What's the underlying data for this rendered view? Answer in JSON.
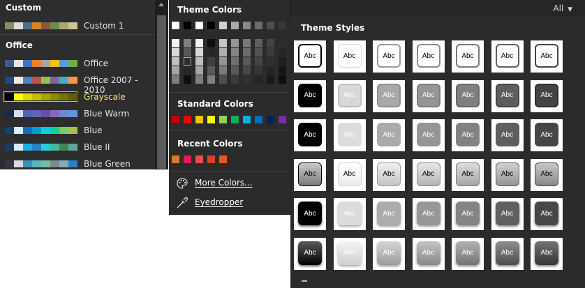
{
  "variants": {
    "custom_heading": "Custom",
    "office_heading": "Office",
    "items": [
      {
        "name": "Custom 1",
        "colors": [
          "#8a8a6c",
          "#dcdcdc",
          "#4a6e8c",
          "#d4852a",
          "#8c5a3a",
          "#6e8a4e",
          "#a8a86a",
          "#c8c890"
        ],
        "selected": false
      },
      {
        "name": "Office",
        "colors": [
          "#3c5a8c",
          "#e6e6e6",
          "#4472c4",
          "#ed7d31",
          "#a5a5a5",
          "#ffc000",
          "#5b9bd5",
          "#70ad47"
        ],
        "selected": false
      },
      {
        "name": "Office 2007 - 2010",
        "colors": [
          "#1f497d",
          "#eeece1",
          "#4f81bd",
          "#c0504d",
          "#9bbb59",
          "#8064a2",
          "#4bacc6",
          "#f79646"
        ],
        "selected": false
      },
      {
        "name": "Grayscale",
        "colors": [
          "#000000",
          "#ffff00",
          "#e0d800",
          "#c8c000",
          "#aaa400",
          "#908a00",
          "#787400",
          "#605e00"
        ],
        "selected": true
      },
      {
        "name": "Blue Warm",
        "colors": [
          "#1a2a4c",
          "#d8dce8",
          "#4a66ac",
          "#5a6ab0",
          "#6a4ea0",
          "#8a68b8",
          "#6a8ac8",
          "#5a9ad8"
        ],
        "selected": false
      },
      {
        "name": "Blue",
        "colors": [
          "#17406d",
          "#dbeff9",
          "#0f6fc6",
          "#009dd9",
          "#0bd0d9",
          "#10cf9b",
          "#7cca62",
          "#a5c249"
        ],
        "selected": false
      },
      {
        "name": "Blue II",
        "colors": [
          "#1c3a6a",
          "#e0e8f0",
          "#1cade4",
          "#2683c6",
          "#27ced7",
          "#42ba97",
          "#3e8853",
          "#62a39f"
        ],
        "selected": false
      },
      {
        "name": "Blue Green",
        "colors": [
          "#373545",
          "#dcd8dc",
          "#3494ba",
          "#58b6c0",
          "#75bda7",
          "#7a8c8e",
          "#84acb6",
          "#2683c6"
        ],
        "selected": false
      }
    ]
  },
  "color_popup": {
    "theme_colors_heading": "Theme Colors",
    "theme_top_row": [
      "#ffffff",
      "#000000",
      "#ffffff",
      "#000000",
      "#d0d0d0",
      "#a8a8a8",
      "#888888",
      "#6c6c6c",
      "#4e4e4e",
      "#383838"
    ],
    "theme_shades": [
      [
        "#f2f2f2",
        "#7f7f7f",
        "#f2f2f2",
        "#0d0d0d",
        "#c6c6c6",
        "#969696",
        "#7a7a7a",
        "#5f5f5f",
        "#444444",
        "#2e2e2e"
      ],
      [
        "#d9d9d9",
        "#595959",
        "#d9d9d9",
        "#262626",
        "#b0b0b0",
        "#858585",
        "#6b6b6b",
        "#525252",
        "#3a3a3a",
        "#262626"
      ],
      [
        "#bfbfbf",
        "#404040",
        "#bfbfbf",
        "#404040",
        "#969696",
        "#707070",
        "#5a5a5a",
        "#454545",
        "#2f2f2f",
        "#1e1e1e"
      ],
      [
        "#a6a6a6",
        "#262626",
        "#a6a6a6",
        "#595959",
        "#7a7a7a",
        "#5a5a5a",
        "#484848",
        "#363636",
        "#242424",
        "#161616"
      ],
      [
        "#7f7f7f",
        "#0d0d0d",
        "#7f7f7f",
        "#7f7f7f",
        "#505050",
        "#3c3c3c",
        "#303030",
        "#242424",
        "#181818",
        "#0e0e0e"
      ]
    ],
    "standard_colors_heading": "Standard Colors",
    "standard_colors": [
      "#c00000",
      "#ff0000",
      "#ffc000",
      "#ffff00",
      "#92d050",
      "#00b050",
      "#00b0f0",
      "#0070c0",
      "#002060",
      "#7030a0"
    ],
    "recent_colors_heading": "Recent Colors",
    "recent_colors": [
      "#e07a18",
      "#e8185a",
      "#e84c4c",
      "#e0402a",
      "#e85a14"
    ],
    "more_colors_label": "More Colors...",
    "eyedropper_label": "Eyedropper",
    "icons": {
      "more_colors": "palette-icon",
      "eyedropper": "eyedropper-icon"
    }
  },
  "theme_styles": {
    "filter_label": "All",
    "heading": "Theme Styles",
    "tile_text": "Abc",
    "rows": [
      [
        {
          "fill": "#ffffff",
          "text": "#000000",
          "border": "#000000",
          "bw": 2,
          "shadow": ""
        },
        {
          "fill": "#ffffff",
          "text": "#000000",
          "border": "#d8d8d8",
          "bw": 1,
          "shadow": ""
        },
        {
          "fill": "#ffffff",
          "text": "#000000",
          "border": "#9a9a9a",
          "bw": 2,
          "shadow": ""
        },
        {
          "fill": "#ffffff",
          "text": "#000000",
          "border": "#8c8c8c",
          "bw": 2,
          "shadow": ""
        },
        {
          "fill": "#ffffff",
          "text": "#000000",
          "border": "#7a7a7a",
          "bw": 2,
          "shadow": ""
        },
        {
          "fill": "#ffffff",
          "text": "#000000",
          "border": "#5e5e5e",
          "bw": 2,
          "shadow": ""
        },
        {
          "fill": "#ffffff",
          "text": "#000000",
          "border": "#454545",
          "bw": 2,
          "shadow": ""
        }
      ],
      [
        {
          "fill": "#000000",
          "text": "#ffffff",
          "border": "#000000",
          "bw": 1,
          "shadow": ""
        },
        {
          "fill": "#d8d8d8",
          "text": "#ffffff",
          "border": "#c0c0c0",
          "bw": 2,
          "shadow": ""
        },
        {
          "fill": "#a8a8a8",
          "text": "#ffffff",
          "border": "#909090",
          "bw": 2,
          "shadow": ""
        },
        {
          "fill": "#959595",
          "text": "#ffffff",
          "border": "#7c7c7c",
          "bw": 2,
          "shadow": ""
        },
        {
          "fill": "#808080",
          "text": "#ffffff",
          "border": "#686868",
          "bw": 2,
          "shadow": ""
        },
        {
          "fill": "#5e5e5e",
          "text": "#ffffff",
          "border": "#484848",
          "bw": 2,
          "shadow": ""
        },
        {
          "fill": "#444444",
          "text": "#ffffff",
          "border": "#303030",
          "bw": 2,
          "shadow": ""
        }
      ],
      [
        {
          "fill": "#000000",
          "text": "#ffffff",
          "border": "#000000",
          "bw": 0,
          "shadow": ""
        },
        {
          "fill": "#dcdcdc",
          "text": "#ffffff",
          "border": "#dcdcdc",
          "bw": 0,
          "shadow": ""
        },
        {
          "fill": "#aaaaaa",
          "text": "#ffffff",
          "border": "#aaaaaa",
          "bw": 0,
          "shadow": ""
        },
        {
          "fill": "#959595",
          "text": "#ffffff",
          "border": "#959595",
          "bw": 0,
          "shadow": ""
        },
        {
          "fill": "#828282",
          "text": "#ffffff",
          "border": "#828282",
          "bw": 0,
          "shadow": ""
        },
        {
          "fill": "#5f5f5f",
          "text": "#ffffff",
          "border": "#5f5f5f",
          "bw": 0,
          "shadow": ""
        },
        {
          "fill": "#464646",
          "text": "#ffffff",
          "border": "#464646",
          "bw": 0,
          "shadow": ""
        }
      ],
      [
        {
          "fill": "linear-gradient(#c8c8c8,#7a7a7a)",
          "text": "#000000",
          "border": "#000000",
          "bw": 1,
          "shadow": ""
        },
        {
          "fill": "linear-gradient(#ffffff,#ececec)",
          "text": "#000000",
          "border": "#d0d0d0",
          "bw": 1,
          "shadow": ""
        },
        {
          "fill": "linear-gradient(#f0f0f0,#c4c4c4)",
          "text": "#000000",
          "border": "#9a9a9a",
          "bw": 1,
          "shadow": ""
        },
        {
          "fill": "linear-gradient(#e6e6e6,#b4b4b4)",
          "text": "#000000",
          "border": "#8a8a8a",
          "bw": 1,
          "shadow": ""
        },
        {
          "fill": "linear-gradient(#dcdcdc,#a6a6a6)",
          "text": "#000000",
          "border": "#7a7a7a",
          "bw": 1,
          "shadow": ""
        },
        {
          "fill": "linear-gradient(#d0d0d0,#949494)",
          "text": "#000000",
          "border": "#5e5e5e",
          "bw": 1,
          "shadow": ""
        },
        {
          "fill": "linear-gradient(#c8c8c8,#888888)",
          "text": "#000000",
          "border": "#454545",
          "bw": 1,
          "shadow": ""
        }
      ],
      [
        {
          "fill": "#000000",
          "text": "#ffffff",
          "border": "#000000",
          "bw": 0,
          "shadow": "0 2px 3px rgba(0,0,0,0.6)"
        },
        {
          "fill": "#dcdcdc",
          "text": "#ffffff",
          "border": "#dcdcdc",
          "bw": 0,
          "shadow": "0 2px 3px rgba(0,0,0,0.35)"
        },
        {
          "fill": "#acacac",
          "text": "#ffffff",
          "border": "#acacac",
          "bw": 0,
          "shadow": "0 2px 3px rgba(0,0,0,0.4)"
        },
        {
          "fill": "#979797",
          "text": "#ffffff",
          "border": "#979797",
          "bw": 0,
          "shadow": "0 2px 3px rgba(0,0,0,0.4)"
        },
        {
          "fill": "#848484",
          "text": "#ffffff",
          "border": "#848484",
          "bw": 0,
          "shadow": "0 2px 3px rgba(0,0,0,0.45)"
        },
        {
          "fill": "#606060",
          "text": "#ffffff",
          "border": "#606060",
          "bw": 0,
          "shadow": "0 2px 3px rgba(0,0,0,0.5)"
        },
        {
          "fill": "#474747",
          "text": "#ffffff",
          "border": "#474747",
          "bw": 0,
          "shadow": "0 2px 3px rgba(0,0,0,0.5)"
        }
      ],
      [
        {
          "fill": "linear-gradient(#5a5a5a,#000000)",
          "text": "#ffffff",
          "border": "#000000",
          "bw": 0,
          "shadow": "0 2px 3px rgba(0,0,0,0.6)"
        },
        {
          "fill": "linear-gradient(#f4f4f4,#cfcfcf)",
          "text": "#ffffff",
          "border": "#cfcfcf",
          "bw": 0,
          "shadow": "0 2px 3px rgba(0,0,0,0.35)"
        },
        {
          "fill": "linear-gradient(#d6d6d6,#9c9c9c)",
          "text": "#ffffff",
          "border": "#9c9c9c",
          "bw": 0,
          "shadow": "0 2px 3px rgba(0,0,0,0.4)"
        },
        {
          "fill": "linear-gradient(#c4c4c4,#888888)",
          "text": "#ffffff",
          "border": "#888888",
          "bw": 0,
          "shadow": "0 2px 3px rgba(0,0,0,0.4)"
        },
        {
          "fill": "linear-gradient(#b2b2b2,#747474)",
          "text": "#ffffff",
          "border": "#747474",
          "bw": 0,
          "shadow": "0 2px 3px rgba(0,0,0,0.45)"
        },
        {
          "fill": "linear-gradient(#8e8e8e,#4e4e4e)",
          "text": "#ffffff",
          "border": "#4e4e4e",
          "bw": 0,
          "shadow": "0 2px 3px rgba(0,0,0,0.5)"
        },
        {
          "fill": "linear-gradient(#727272,#363636)",
          "text": "#ffffff",
          "border": "#363636",
          "bw": 0,
          "shadow": "0 2px 3px rgba(0,0,0,0.5)"
        }
      ]
    ]
  }
}
